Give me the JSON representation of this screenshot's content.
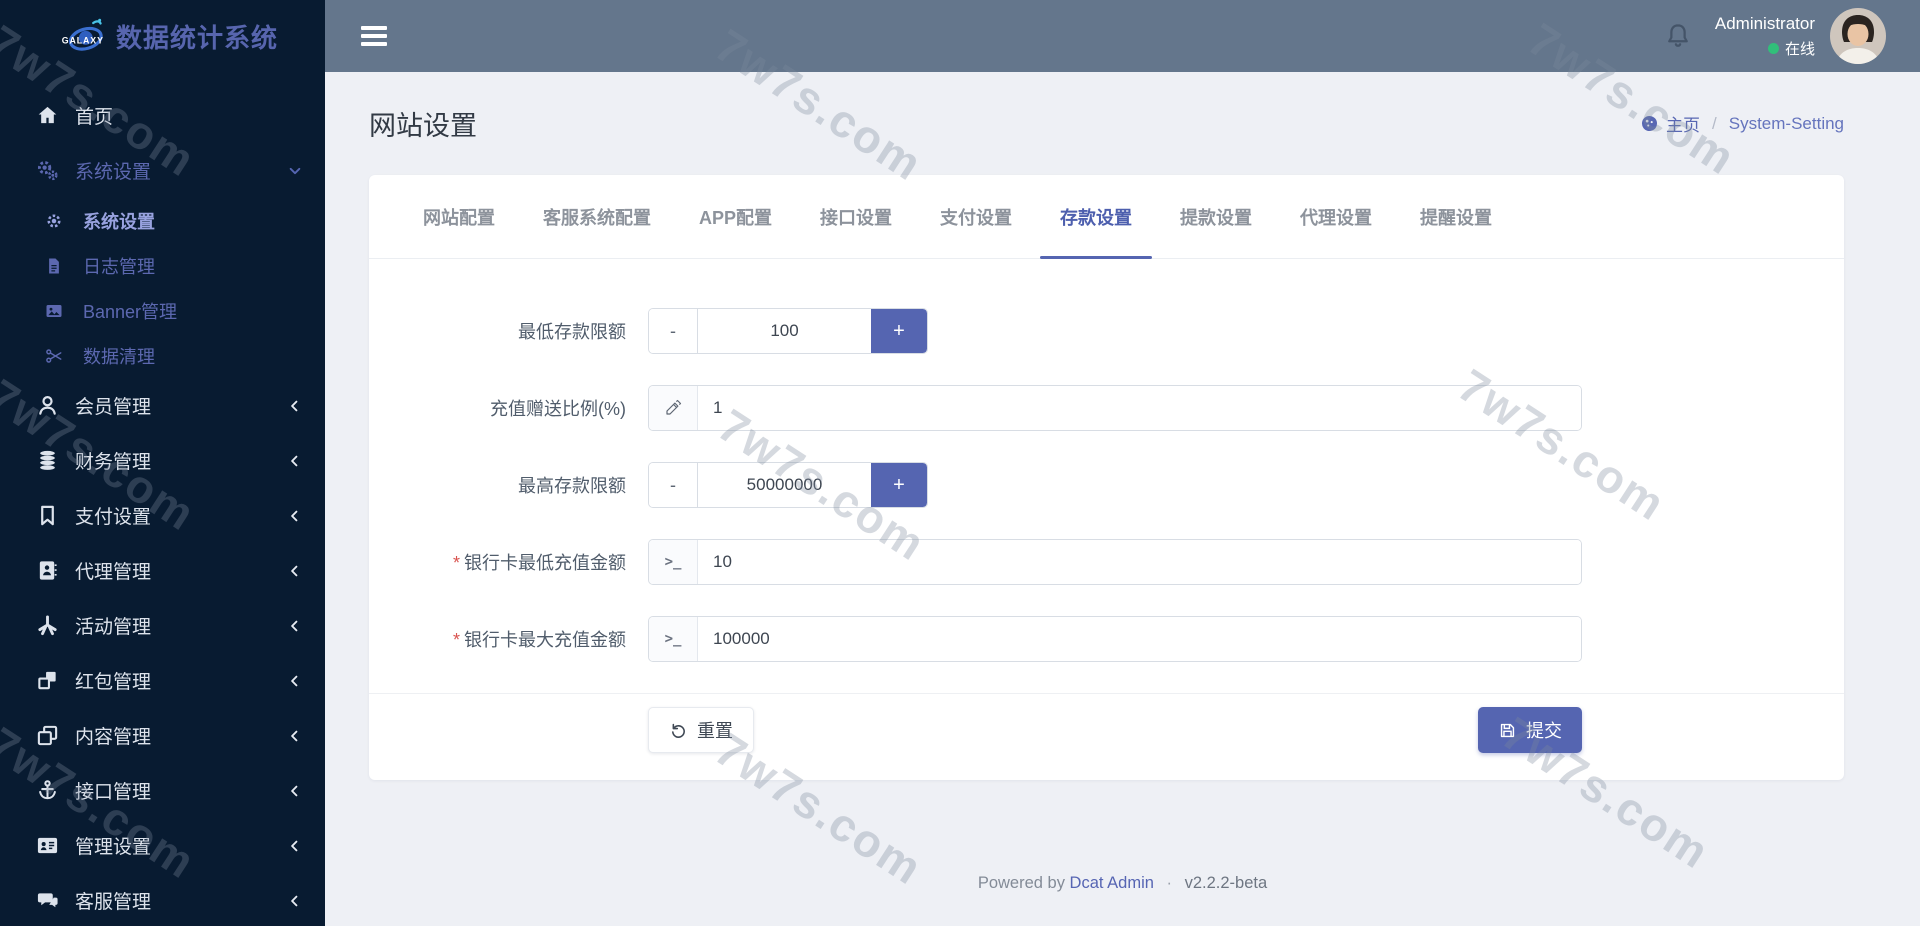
{
  "watermark": "7w7s.com",
  "colors": {
    "primary": "#5565b1",
    "sidebar_bg": "#081b31",
    "header_bg": "#64768c",
    "page_bg": "#eef0f5",
    "online_green": "#31bf7a",
    "required_red": "#d9534f",
    "active_tab": "#4d5fae"
  },
  "sidebar": {
    "logo_mark": "GALAXY",
    "logo_text": "数据统计系统",
    "items": [
      {
        "label": "首页"
      },
      {
        "label": "系统设置"
      },
      {
        "label": "系统设置"
      },
      {
        "label": "日志管理"
      },
      {
        "label": "Banner管理"
      },
      {
        "label": "数据清理"
      },
      {
        "label": "会员管理"
      },
      {
        "label": "财务管理"
      },
      {
        "label": "支付设置"
      },
      {
        "label": "代理管理"
      },
      {
        "label": "活动管理"
      },
      {
        "label": "红包管理"
      },
      {
        "label": "内容管理"
      },
      {
        "label": "接口管理"
      },
      {
        "label": "管理设置"
      },
      {
        "label": "客服管理"
      }
    ]
  },
  "header": {
    "user_name": "Administrator",
    "user_status": "在线"
  },
  "page": {
    "title": "网站设置",
    "breadcrumb_home": "主页",
    "breadcrumb_sep": "/",
    "breadcrumb_current": "System-Setting"
  },
  "tabs": [
    {
      "label": "网站配置"
    },
    {
      "label": "客服系统配置"
    },
    {
      "label": "APP配置"
    },
    {
      "label": "接口设置"
    },
    {
      "label": "支付设置"
    },
    {
      "label": "存款设置"
    },
    {
      "label": "提款设置"
    },
    {
      "label": "代理设置"
    },
    {
      "label": "提醒设置"
    }
  ],
  "form": {
    "rows": [
      {
        "label": "最低存款限额",
        "value": "100",
        "type": "stepper"
      },
      {
        "label": "充值赠送比例(%)",
        "value": "1",
        "type": "text"
      },
      {
        "label": "最高存款限额",
        "value": "50000000",
        "type": "stepper"
      },
      {
        "label": "银行卡最低充值金额",
        "value": "10",
        "required": "*",
        "type": "text"
      },
      {
        "label": "银行卡最大充值金额",
        "value": "100000",
        "required": "*",
        "type": "text"
      }
    ],
    "stepper_minus": "-",
    "stepper_plus": "+",
    "terminal_glyph": ">_",
    "reset_label": "重置",
    "submit_label": "提交"
  },
  "footer": {
    "powered_by": "Powered by",
    "brand_link": "Dcat Admin",
    "separator": "·",
    "version": "v2.2.2-beta"
  }
}
